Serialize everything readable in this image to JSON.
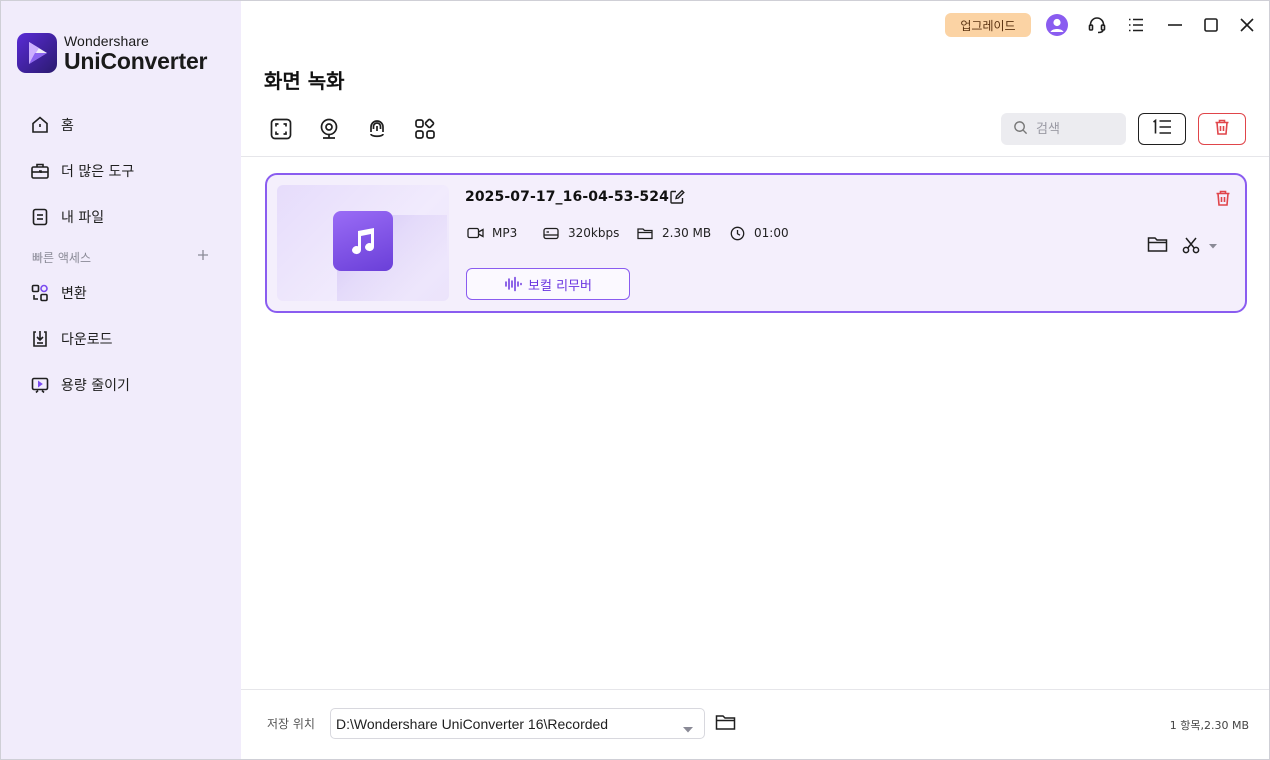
{
  "app": {
    "brand_line1": "Wondershare",
    "brand_line2": "UniConverter"
  },
  "sidebar": {
    "items": [
      {
        "label": "홈",
        "icon": "home-icon"
      },
      {
        "label": "더 많은 도구",
        "icon": "toolbox-icon"
      },
      {
        "label": "내 파일",
        "icon": "file-icon"
      }
    ],
    "quick_access_label": "빠른 액세스",
    "quick_items": [
      {
        "label": "변환",
        "icon": "convert-icon"
      },
      {
        "label": "다운로드",
        "icon": "download-icon"
      },
      {
        "label": "용량 줄이기",
        "icon": "compress-icon"
      }
    ]
  },
  "titlebar": {
    "upgrade_label": "업그레이드"
  },
  "page": {
    "title": "화면 녹화"
  },
  "search": {
    "placeholder": "검색"
  },
  "file": {
    "name": "2025-07-17_16-04-53-524",
    "format": "MP3",
    "bitrate": "320kbps",
    "size": "2.30 MB",
    "duration": "01:00",
    "vocal_button": "보컬 리무버"
  },
  "footer": {
    "save_label": "저장 위치",
    "path": "D:\\Wondershare UniConverter 16\\Recorded",
    "summary": "1 항목,2.30 MB"
  },
  "colors": {
    "accent": "#8a5cf0",
    "sidebar_bg": "#f1ecfb",
    "upgrade_bg": "#fbd3a4",
    "danger": "#e0454a"
  }
}
